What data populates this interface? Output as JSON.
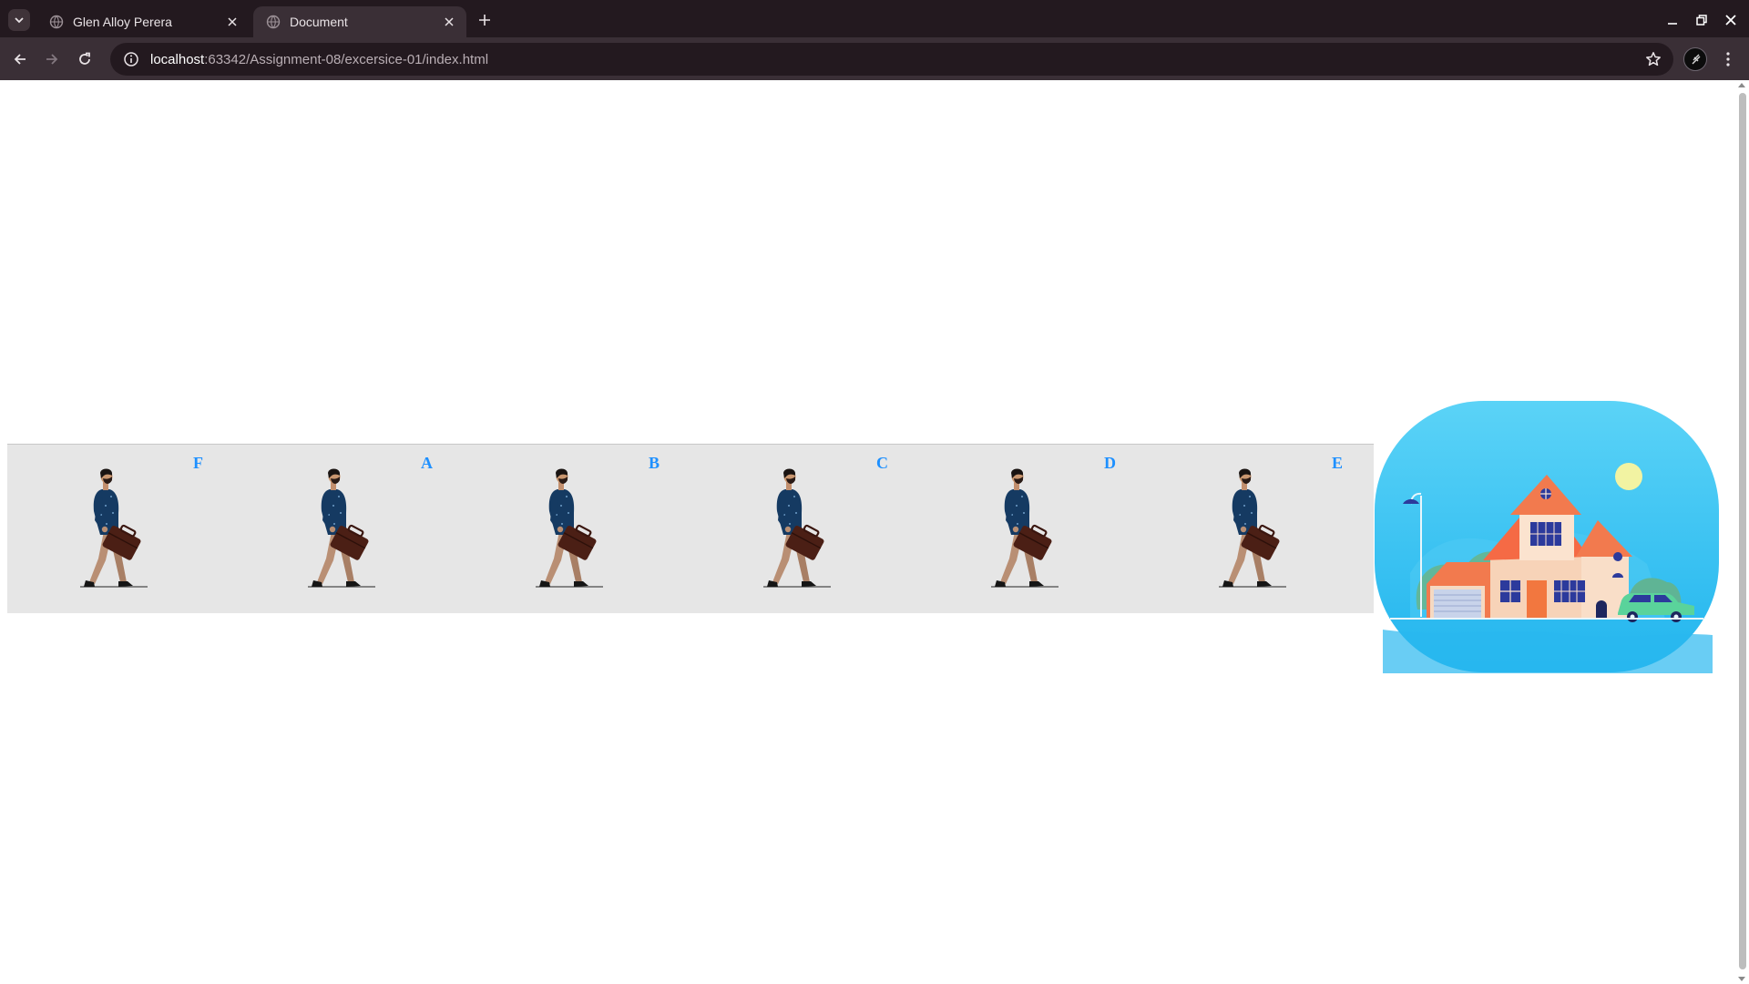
{
  "browser": {
    "tabs": [
      {
        "title": "Glen Alloy Perera",
        "active": false
      },
      {
        "title": "Document",
        "active": true
      }
    ],
    "address": {
      "host": "localhost",
      "path": ":63342/Assignment-08/excersice-01/index.html"
    },
    "icons": {
      "tab_search": "chevron-down-icon",
      "new_tab": "plus-icon",
      "back": "arrow-left-icon",
      "forward": "arrow-right-icon",
      "reload": "reload-icon",
      "site_info": "info-icon",
      "bookmark": "star-icon",
      "profile": "avatar-icon",
      "menu": "kebab-menu-icon",
      "minimize": "minimize-icon",
      "maximize": "restore-icon",
      "close_window": "close-icon"
    },
    "colors": {
      "tabstrip_bg": "#23191f",
      "toolbar_bg": "#3a2f36"
    }
  },
  "page": {
    "walker_cells": [
      {
        "letter": "F"
      },
      {
        "letter": "A"
      },
      {
        "letter": "B"
      },
      {
        "letter": "C"
      },
      {
        "letter": "D"
      },
      {
        "letter": "E"
      }
    ],
    "colors": {
      "strip_bg": "#e6e6e6",
      "letter_color": "#1e90ff",
      "bubble_color": "#3fc6f5"
    }
  }
}
